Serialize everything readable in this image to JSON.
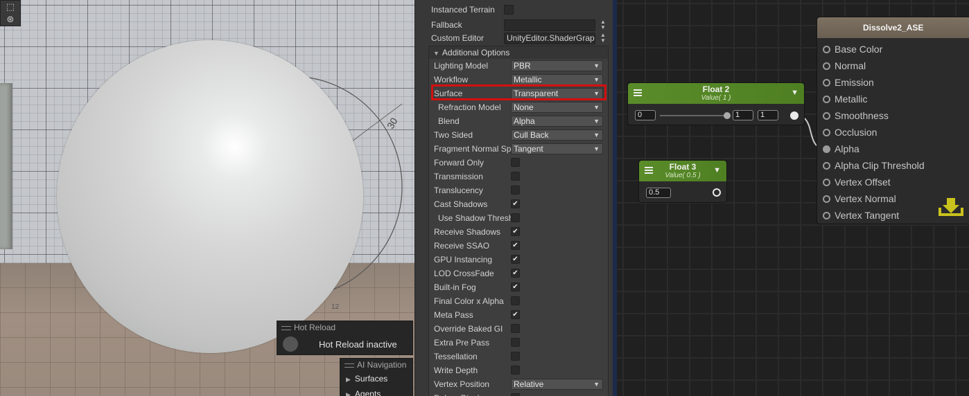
{
  "scene": {
    "ring_label": "30",
    "tick_label": "12",
    "hot_reload": {
      "title": "Hot Reload",
      "status": "Hot Reload inactive"
    },
    "ai_navigation": {
      "title": "AI Navigation",
      "items": [
        "Surfaces",
        "Agents"
      ]
    }
  },
  "inspector": {
    "instanced_terrain": {
      "label": "Instanced Terrain",
      "checked": false
    },
    "fallback": {
      "label": "Fallback",
      "value": ""
    },
    "custom_editor": {
      "label": "Custom Editor",
      "value": "UnityEditor.ShaderGrap"
    },
    "additional_options": {
      "title": "Additional Options",
      "rows": [
        {
          "label": "Lighting Model",
          "kind": "dropdown",
          "value": "PBR"
        },
        {
          "label": "Workflow",
          "kind": "dropdown",
          "value": "Metallic"
        },
        {
          "label": "Surface",
          "kind": "dropdown",
          "value": "Transparent"
        },
        {
          "label": "Refraction Model",
          "kind": "dropdown",
          "value": "None",
          "indent": true
        },
        {
          "label": "Blend",
          "kind": "dropdown",
          "value": "Alpha",
          "indent": true
        },
        {
          "label": "Two Sided",
          "kind": "dropdown",
          "value": "Cull Back"
        },
        {
          "label": "Fragment Normal Space",
          "kind": "dropdown",
          "value": "Tangent"
        },
        {
          "label": "Forward Only",
          "kind": "check",
          "checked": false
        },
        {
          "label": "Transmission",
          "kind": "check",
          "checked": false
        },
        {
          "label": "Translucency",
          "kind": "check",
          "checked": false
        },
        {
          "label": "Cast Shadows",
          "kind": "check",
          "checked": true
        },
        {
          "label": "Use Shadow Threshold",
          "kind": "check",
          "checked": false,
          "indent": true
        },
        {
          "label": "Receive Shadows",
          "kind": "check",
          "checked": true
        },
        {
          "label": "Receive SSAO",
          "kind": "check",
          "checked": true
        },
        {
          "label": "GPU Instancing",
          "kind": "check",
          "checked": true
        },
        {
          "label": "LOD CrossFade",
          "kind": "check",
          "checked": true
        },
        {
          "label": "Built-in Fog",
          "kind": "check",
          "checked": true
        },
        {
          "label": "Final Color x Alpha",
          "kind": "check",
          "checked": false
        },
        {
          "label": "Meta Pass",
          "kind": "check",
          "checked": true
        },
        {
          "label": "Override Baked GI",
          "kind": "check",
          "checked": false
        },
        {
          "label": "Extra Pre Pass",
          "kind": "check",
          "checked": false
        },
        {
          "label": "Tessellation",
          "kind": "check",
          "checked": false
        },
        {
          "label": "Write Depth",
          "kind": "check",
          "checked": false
        },
        {
          "label": "Vertex Position",
          "kind": "dropdown",
          "value": "Relative"
        },
        {
          "label": "Debug Display",
          "kind": "check",
          "checked": false
        }
      ]
    }
  },
  "graph": {
    "float2": {
      "title": "Float 2",
      "subtitle": "Value( 1 )",
      "min": "0",
      "value": "1",
      "max": "1",
      "slider_fraction": 1.0
    },
    "float3": {
      "title": "Float 3",
      "subtitle": "Value( 0.5 )",
      "value": "0.5"
    },
    "output": {
      "title": "Dissolve2_ASE",
      "ports": [
        "Base Color",
        "Normal",
        "Emission",
        "Metallic",
        "Smoothness",
        "Occlusion",
        "Alpha",
        "Alpha Clip Threshold",
        "Vertex Offset",
        "Vertex Normal",
        "Vertex Tangent"
      ],
      "connected_port": "Alpha"
    }
  },
  "colors": {
    "highlight": "#d40f0f",
    "node_header": "#5a8c2a",
    "output_header": "#756a5a"
  }
}
